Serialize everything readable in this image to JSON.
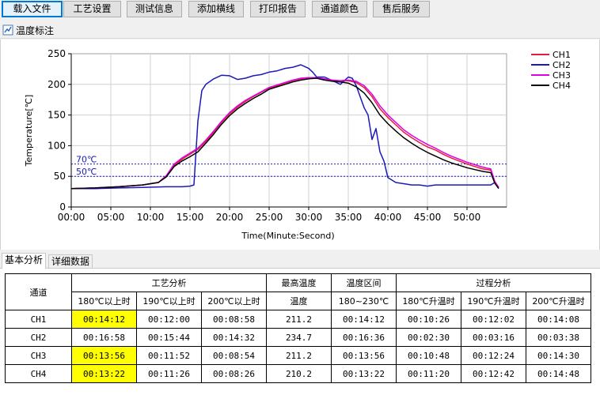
{
  "toolbar": {
    "buttons": [
      "载入文件",
      "工艺设置",
      "测试信息",
      "添加横线",
      "打印报告",
      "通道颜色",
      "售后服务"
    ]
  },
  "annotation": {
    "label": "温度标注",
    "icon": "temperature-icon"
  },
  "chart_data": {
    "type": "line",
    "ylabel": "Temperature[℃]",
    "xlabel": "Time(Minute:Second)",
    "ylim": [
      0,
      250
    ],
    "yticks": [
      "0",
      "50",
      "100",
      "150",
      "200",
      "250"
    ],
    "xlim_seconds": [
      0,
      3300
    ],
    "xticks": [
      "00:00",
      "05:00",
      "10:00",
      "15:00",
      "20:00",
      "25:00",
      "30:00",
      "35:00",
      "40:00",
      "45:00",
      "50:00"
    ],
    "grid": true,
    "legend": "right",
    "reference_lines": [
      {
        "label": "70℃",
        "value": 70
      },
      {
        "label": "50℃",
        "value": 50
      }
    ],
    "series": [
      {
        "name": "CH1",
        "color": "#e0203a",
        "x": [
          "00:00",
          "03:00",
          "06:00",
          "09:00",
          "11:00",
          "12:00",
          "13:00",
          "14:00",
          "15:00",
          "16:00",
          "17:00",
          "18:00",
          "19:00",
          "20:00",
          "21:00",
          "22:00",
          "23:00",
          "24:00",
          "25:00",
          "26:00",
          "27:00",
          "28:00",
          "29:00",
          "30:00",
          "31:00",
          "32:00",
          "33:00",
          "34:00",
          "35:00",
          "36:00",
          "37:00",
          "38:00",
          "39:00",
          "40:00",
          "41:00",
          "42:00",
          "43:00",
          "44:00",
          "45:00",
          "46:00",
          "47:00",
          "48:00",
          "49:00",
          "50:00",
          "51:00",
          "52:00",
          "53:00",
          "53:30",
          "54:00"
        ],
        "y": [
          30,
          31,
          33,
          36,
          40,
          50,
          68,
          78,
          86,
          94,
          107,
          122,
          138,
          152,
          163,
          172,
          180,
          187,
          194,
          198,
          202,
          206,
          209,
          211,
          211,
          208,
          206,
          205,
          206,
          203,
          195,
          180,
          160,
          146,
          134,
          122,
          113,
          105,
          98,
          93,
          86,
          80,
          75,
          70,
          66,
          62,
          60,
          40,
          31
        ]
      },
      {
        "name": "CH2",
        "color": "#1a1ab8",
        "x": [
          "00:00",
          "03:00",
          "06:00",
          "09:00",
          "12:00",
          "14:00",
          "15:00",
          "15:30",
          "16:00",
          "16:30",
          "17:00",
          "18:00",
          "19:00",
          "20:00",
          "21:00",
          "22:00",
          "23:00",
          "24:00",
          "25:00",
          "26:00",
          "27:00",
          "28:00",
          "29:00",
          "30:00",
          "30:30",
          "31:00",
          "32:00",
          "33:00",
          "34:00",
          "35:00",
          "35:30",
          "36:00",
          "37:00",
          "37:30",
          "38:00",
          "38:30",
          "39:00",
          "39:30",
          "40:00",
          "41:00",
          "42:00",
          "43:00",
          "44:00",
          "45:00",
          "46:00",
          "48:00",
          "50:00",
          "52:00",
          "53:00",
          "53:30",
          "54:00"
        ],
        "y": [
          30,
          30,
          31,
          32,
          33,
          33,
          34,
          36,
          140,
          190,
          200,
          209,
          215,
          214,
          208,
          210,
          214,
          216,
          220,
          222,
          226,
          228,
          232,
          226,
          220,
          212,
          212,
          206,
          200,
          212,
          210,
          198,
          162,
          150,
          110,
          128,
          90,
          75,
          48,
          40,
          38,
          36,
          36,
          34,
          36,
          36,
          36,
          36,
          36,
          40,
          32
        ]
      },
      {
        "name": "CH3",
        "color": "#e000e0",
        "x": [
          "00:00",
          "03:00",
          "06:00",
          "09:00",
          "11:00",
          "12:00",
          "13:00",
          "14:00",
          "15:00",
          "16:00",
          "17:00",
          "18:00",
          "19:00",
          "20:00",
          "21:00",
          "22:00",
          "23:00",
          "24:00",
          "25:00",
          "26:00",
          "27:00",
          "28:00",
          "29:00",
          "30:00",
          "31:00",
          "32:00",
          "33:00",
          "34:00",
          "35:00",
          "36:00",
          "37:00",
          "38:00",
          "39:00",
          "40:00",
          "41:00",
          "42:00",
          "43:00",
          "44:00",
          "45:00",
          "46:00",
          "47:00",
          "48:00",
          "49:00",
          "50:00",
          "51:00",
          "52:00",
          "53:00",
          "53:30",
          "54:00"
        ],
        "y": [
          30,
          31,
          33,
          36,
          40,
          51,
          70,
          80,
          88,
          96,
          109,
          124,
          140,
          154,
          165,
          174,
          181,
          188,
          195,
          199,
          203,
          207,
          210,
          211,
          211,
          209,
          207,
          206,
          207,
          205,
          198,
          184,
          165,
          150,
          138,
          126,
          117,
          109,
          102,
          96,
          89,
          83,
          78,
          73,
          69,
          65,
          62,
          42,
          32
        ]
      },
      {
        "name": "CH4",
        "color": "#000000",
        "x": [
          "00:00",
          "03:00",
          "06:00",
          "09:00",
          "11:00",
          "12:00",
          "13:00",
          "14:00",
          "15:00",
          "16:00",
          "17:00",
          "18:00",
          "19:00",
          "20:00",
          "21:00",
          "22:00",
          "23:00",
          "24:00",
          "25:00",
          "26:00",
          "27:00",
          "28:00",
          "29:00",
          "30:00",
          "31:00",
          "32:00",
          "33:00",
          "34:00",
          "35:00",
          "36:00",
          "37:00",
          "38:00",
          "39:00",
          "40:00",
          "41:00",
          "42:00",
          "43:00",
          "44:00",
          "45:00",
          "46:00",
          "47:00",
          "48:00",
          "49:00",
          "50:00",
          "51:00",
          "52:00",
          "53:00",
          "53:30",
          "54:00"
        ],
        "y": [
          30,
          31,
          33,
          36,
          40,
          49,
          66,
          75,
          82,
          90,
          104,
          119,
          135,
          149,
          160,
          169,
          177,
          184,
          192,
          196,
          200,
          204,
          207,
          209,
          210,
          207,
          205,
          204,
          202,
          196,
          186,
          170,
          150,
          136,
          124,
          113,
          104,
          96,
          89,
          83,
          77,
          72,
          68,
          64,
          61,
          58,
          56,
          39,
          30
        ]
      }
    ]
  },
  "tabs": [
    "基本分析",
    "详细数据"
  ],
  "table": {
    "h_channel": "通道",
    "h_process": "工艺分析",
    "h_max": "最高温度",
    "h_range": "温度区间",
    "h_progress": "过程分析",
    "sub": [
      "180℃以上时",
      "190℃以上时",
      "200℃以上时",
      "温度",
      "180~230℃",
      "180℃升温时",
      "190℃升温时",
      "200℃升温时"
    ],
    "rows": [
      {
        "ch": "CH1",
        "t180": "00:14:12",
        "t190": "00:12:00",
        "t200": "00:08:58",
        "max": "211.2",
        "range": "00:14:12",
        "r180": "00:10:26",
        "r190": "00:12:02",
        "r200": "00:14:08",
        "hl": true
      },
      {
        "ch": "CH2",
        "t180": "00:16:58",
        "t190": "00:15:44",
        "t200": "00:14:32",
        "max": "234.7",
        "range": "00:16:36",
        "r180": "00:02:30",
        "r190": "00:03:16",
        "r200": "00:03:38",
        "hl": false
      },
      {
        "ch": "CH3",
        "t180": "00:13:56",
        "t190": "00:11:52",
        "t200": "00:08:54",
        "max": "211.2",
        "range": "00:13:56",
        "r180": "00:10:48",
        "r190": "00:12:24",
        "r200": "00:14:30",
        "hl": true
      },
      {
        "ch": "CH4",
        "t180": "00:13:22",
        "t190": "00:11:26",
        "t200": "00:08:26",
        "max": "210.2",
        "range": "00:13:22",
        "r180": "00:11:20",
        "r190": "00:12:42",
        "r200": "00:14:48",
        "hl": true
      }
    ]
  }
}
